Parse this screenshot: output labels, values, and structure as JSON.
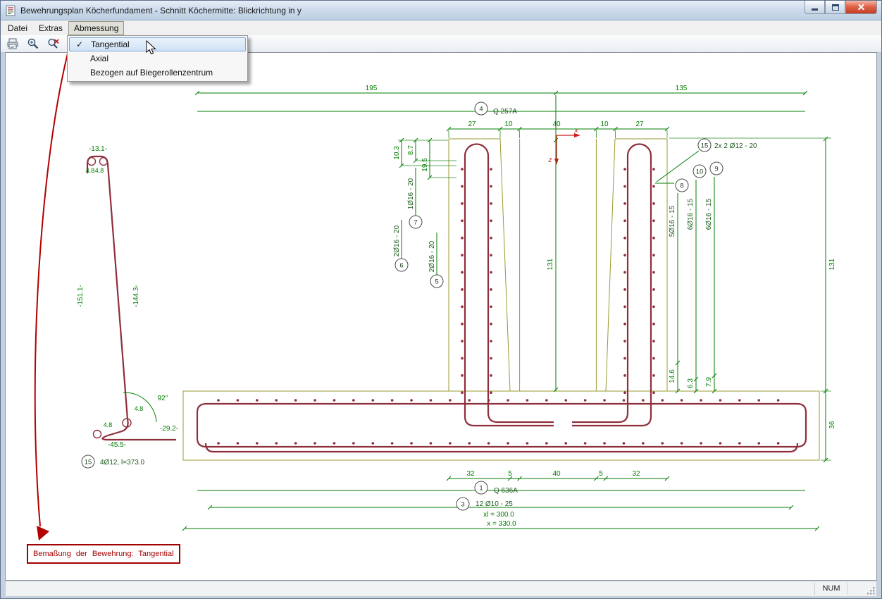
{
  "window": {
    "title": "Bewehrungsplan Köcherfundament - Schnitt Köchermitte: Blickrichtung in y"
  },
  "menu": {
    "items": [
      {
        "label": "Datei"
      },
      {
        "label": "Extras"
      },
      {
        "label": "Abmessung",
        "open": true
      }
    ]
  },
  "dropdown": {
    "checkmark": "✓",
    "items": [
      {
        "label": "Tangential",
        "checked": true
      },
      {
        "label": "Axial",
        "checked": false
      },
      {
        "label": "Bezogen auf Biegerollenzentrum",
        "checked": false
      }
    ]
  },
  "toolbar": {
    "icons": [
      "print-icon",
      "zoom-icon",
      "zoom-cancel-icon"
    ]
  },
  "statusbar": {
    "num_indicator": "NUM"
  },
  "annotation": {
    "text": "Bemaßung der Bewehrung: Tangential"
  },
  "colors": {
    "rebar": "#8e2f3c",
    "dimension_green": "#007d00",
    "concrete_outline": "#9a9a30",
    "annotation_red": "#b30000"
  },
  "drawing": {
    "dim_195": "195",
    "dim_135": "135",
    "pos_4": "4",
    "q_257a": "Q 257A",
    "top_27l": "27",
    "top_10l": "10",
    "top_40": "40",
    "top_10r": "10",
    "top_27r": "27",
    "axis_x": "x",
    "axis_z": "z",
    "dim_10_3": "10.3",
    "dim_8_7": "8.7",
    "dim_19_5": "19.5",
    "pos_7": "7",
    "bar_7": "1Ø16 - 20",
    "pos_6": "6",
    "bar_6": "2Ø16 - 20",
    "pos_5": "5",
    "bar_5": "2Ø16 - 20",
    "dim_131_center": "131",
    "pos_15": "15",
    "bar_15": "2x 2 Ø12 - 20",
    "pos_8": "8",
    "bar_8": "5Ø16 - 15",
    "pos_10": "10",
    "bar_10": "6Ø16 - 15",
    "pos_9": "9",
    "bar_9": "6Ø16 - 15",
    "dim_14_6": "14.6",
    "dim_6_3": "6.3",
    "dim_7_9": "7.9",
    "dim_131_right": "131",
    "dim_36": "36",
    "bot_32l": "32",
    "bot_5l": "5",
    "bot_40": "40",
    "bot_5r": "5",
    "bot_32r": "32",
    "pos_1": "1",
    "q_636a": "Q 636A",
    "pos_3": "3",
    "bar_3": "12 Ø10 - 25",
    "dim_xl": "xl = 300.0",
    "dim_x": "x = 330.0",
    "detail": {
      "dim_13_1": "-13.1-",
      "radius_4_8": "4.8",
      "dim_151_1": "-151.1-",
      "dim_144_3": "-144.3-",
      "angle_92": "92°",
      "dim_29_2": "-29.2-",
      "dim_45_5": "-45.5-",
      "bar_15_length": "4Ø12, l=373.0"
    }
  }
}
